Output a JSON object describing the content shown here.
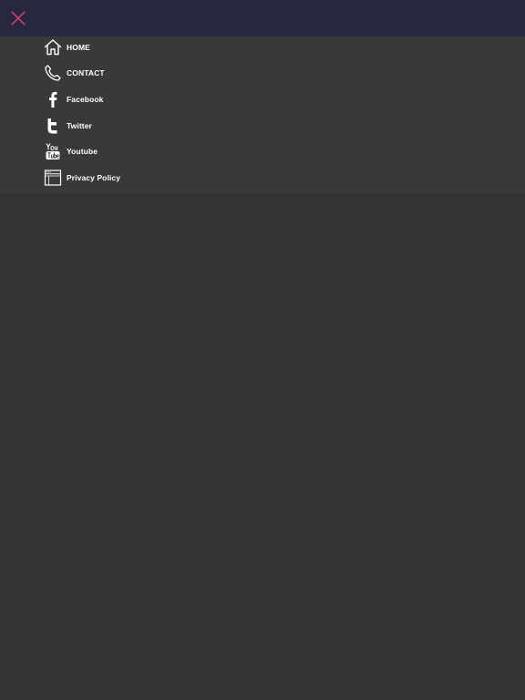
{
  "colors": {
    "topbar_bg": "#272740",
    "menu_bg": "#393939",
    "page_bg": "#333333",
    "close_accent": "#e0407a",
    "text": "#ffffff"
  },
  "header": {
    "close_icon": "close-x-icon"
  },
  "menu": {
    "items": [
      {
        "label": "HOME",
        "icon": "home-icon"
      },
      {
        "label": "CONTACT",
        "icon": "phone-icon"
      },
      {
        "label": "Facebook",
        "icon": "facebook-icon"
      },
      {
        "label": "Twitter",
        "icon": "twitter-icon"
      },
      {
        "label": "Youtube",
        "icon": "youtube-icon"
      },
      {
        "label": "Privacy Policy",
        "icon": "browser-window-icon"
      }
    ]
  }
}
